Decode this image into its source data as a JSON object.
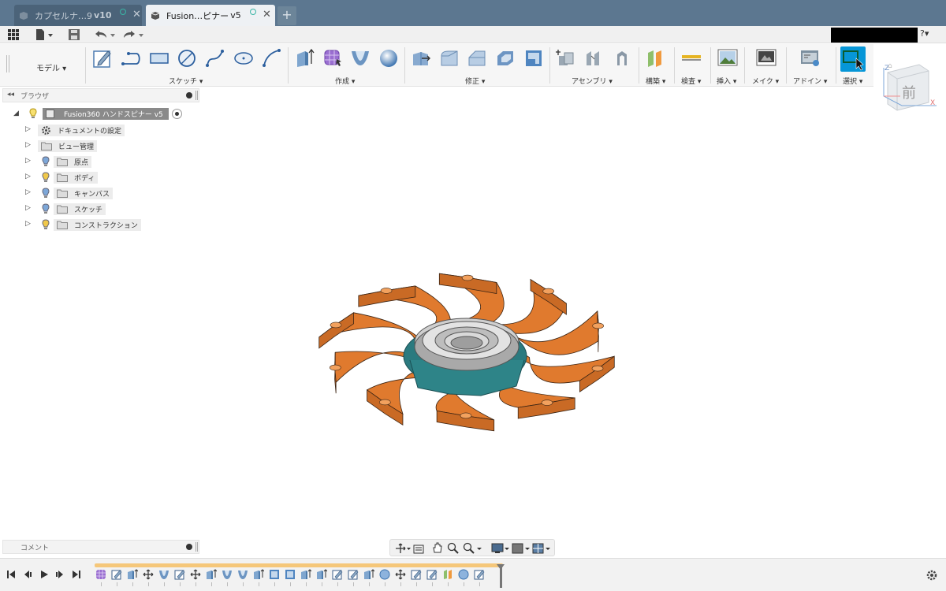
{
  "tabs": [
    {
      "label": "カプセルナ…9",
      "version": "v10",
      "active": false
    },
    {
      "label": "Fusion…ピナー",
      "version": "v5",
      "active": true
    }
  ],
  "new_tab": "+",
  "help": "?▾",
  "ribbon": {
    "workspace": "モデル ▾",
    "groups": [
      {
        "label": "スケッチ ▾"
      },
      {
        "label": "作成 ▾"
      },
      {
        "label": "修正 ▾"
      },
      {
        "label": "アセンブリ ▾"
      },
      {
        "label": "構築 ▾"
      },
      {
        "label": "検査 ▾"
      },
      {
        "label": "挿入 ▾"
      },
      {
        "label": "メイク ▾"
      },
      {
        "label": "アドイン ▾"
      },
      {
        "label": "選択 ▾"
      }
    ]
  },
  "viewcube": {
    "face": "前",
    "axis_x": "X",
    "axis_z": "Z"
  },
  "browser": {
    "collapse": "◂◂",
    "title": "ブラウザ",
    "root": "Fusion360 ハンドスピナー v5",
    "items": [
      {
        "label": "ドキュメントの設定",
        "icon": "gear-icon",
        "bulb": false
      },
      {
        "label": "ビュー管理",
        "icon": "folder-icon",
        "bulb": false
      },
      {
        "label": "原点",
        "icon": "folder-icon",
        "bulb": true,
        "bulb_color": "#7da7d8"
      },
      {
        "label": "ボディ",
        "icon": "folder-icon",
        "bulb": true,
        "bulb_color": "#f0c84a"
      },
      {
        "label": "キャンバス",
        "icon": "folder-icon",
        "bulb": true,
        "bulb_color": "#7da7d8"
      },
      {
        "label": "スケッチ",
        "icon": "folder-icon",
        "bulb": true,
        "bulb_color": "#7da7d8"
      },
      {
        "label": "コンストラクション",
        "icon": "folder-icon",
        "bulb": true,
        "bulb_color": "#f0c84a"
      }
    ]
  },
  "comments": {
    "title": "コメント"
  },
  "colors": {
    "accent": "#0696d7",
    "body": "#e07a2e",
    "bearing": "#b9b9b9",
    "hub": "#2b7a7f",
    "tab_bar": "#5c7790"
  }
}
